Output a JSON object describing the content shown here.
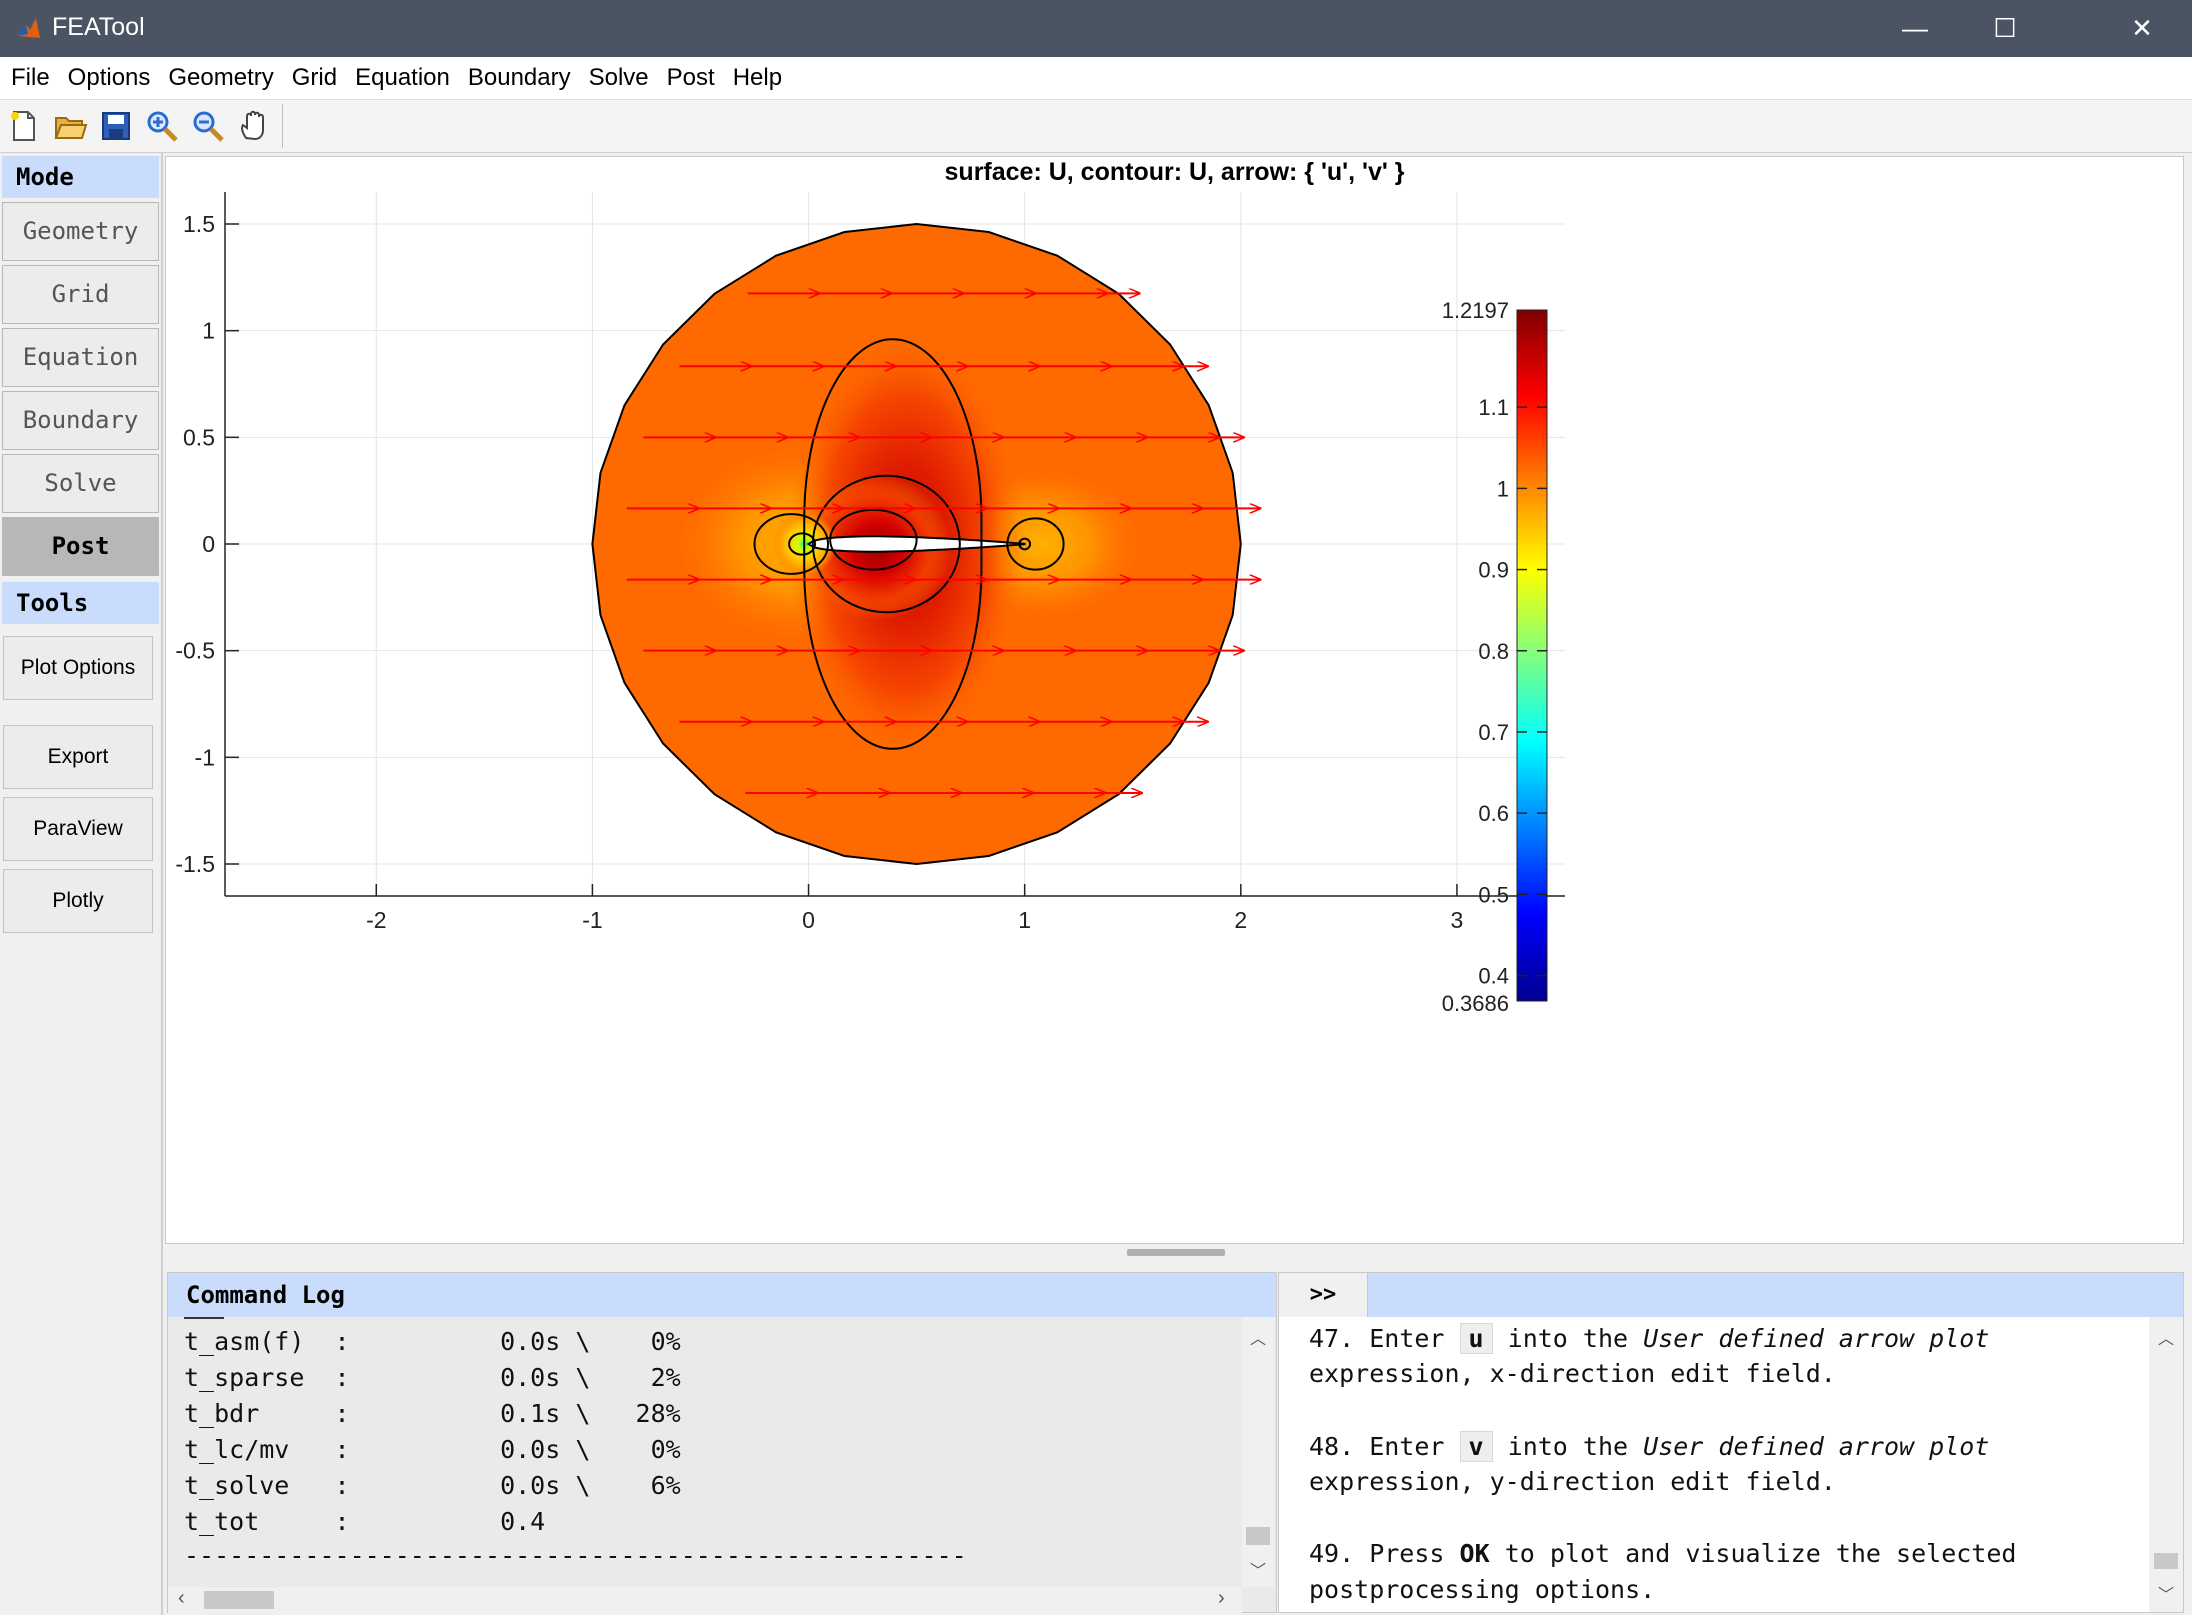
{
  "window": {
    "title": "FEATool",
    "controls": {
      "minimize": "—",
      "maximize": "☐",
      "close": "✕"
    }
  },
  "menu": [
    "File",
    "Options",
    "Geometry",
    "Grid",
    "Equation",
    "Boundary",
    "Solve",
    "Post",
    "Help"
  ],
  "toolbar": [
    "new-file-icon",
    "open-folder-icon",
    "save-icon",
    "zoom-in-icon",
    "zoom-out-icon",
    "pan-hand-icon"
  ],
  "sidebar": {
    "mode_header": "Mode",
    "modes": [
      "Geometry",
      "Grid",
      "Equation",
      "Boundary",
      "Solve",
      "Post"
    ],
    "active_mode": "Post",
    "tools_header": "Tools",
    "tools": [
      "Plot Options",
      "Export",
      "ParaView",
      "Plotly"
    ]
  },
  "plot": {
    "title": "surface: U, contour: U, arrow: { 'u', 'v' }",
    "colormap": "jet"
  },
  "chart_data": {
    "type": "heatmap",
    "title": "surface: U, contour: U, arrow: { 'u', 'v' }",
    "xlabel": "",
    "ylabel": "",
    "xlim": [
      -2.7,
      3.5
    ],
    "ylim": [
      -1.65,
      1.65
    ],
    "xticks": [
      "-2",
      "-1",
      "0",
      "1",
      "2",
      "3"
    ],
    "yticks": [
      "1.5",
      "1",
      "0.5",
      "0",
      "-0.5",
      "-1",
      "-1.5"
    ],
    "grid": true,
    "domain": {
      "shape": "circle",
      "center": [
        0.5,
        0
      ],
      "radius": 1.5,
      "obstacle": "airfoil from x=0 to x=1"
    },
    "colorbar": {
      "min": 0.3686,
      "max": 1.2197,
      "min_label": "0.3686",
      "max_label": "1.2197",
      "ticks": [
        "1.1",
        "1",
        "0.9",
        "0.8",
        "0.7",
        "0.6",
        "0.5",
        "0.4"
      ]
    },
    "arrow_rows_y": [
      1.175,
      0.833,
      0.5,
      0.167,
      -0.167,
      -0.5,
      -0.833,
      -1.167
    ]
  },
  "command_log": {
    "header": "Command Log",
    "lines": [
      "t_asm(f)  :          0.0s \\    0%",
      "t_sparse  :          0.0s \\    2%",
      "t_bdr     :          0.1s \\   28%",
      "t_lc/mv   :          0.0s \\    0%",
      "t_solve   :          0.0s \\    6%",
      "t_tot     :          0.4",
      "----------------------------------------------------"
    ]
  },
  "tutorial": {
    "toggle": ">>",
    "step47": {
      "num": "47. Enter",
      "key": "u",
      "rest": "into the",
      "italic": "User defined arrow plot",
      "line2": "expression, x-direction edit field."
    },
    "step48": {
      "num": "48. Enter",
      "key": "v",
      "rest": "into the",
      "italic": "User defined arrow plot",
      "line2": "expression, y-direction edit field."
    },
    "step49": {
      "num": "49. Press",
      "key": "OK",
      "rest": "to plot and visualize the selected",
      "line2": "postprocessing options."
    }
  },
  "colors": {
    "accent": "#c9dcfb",
    "titlebar": "#4a5462",
    "arrow": "#ff0000",
    "surface": "#ff6a00"
  }
}
